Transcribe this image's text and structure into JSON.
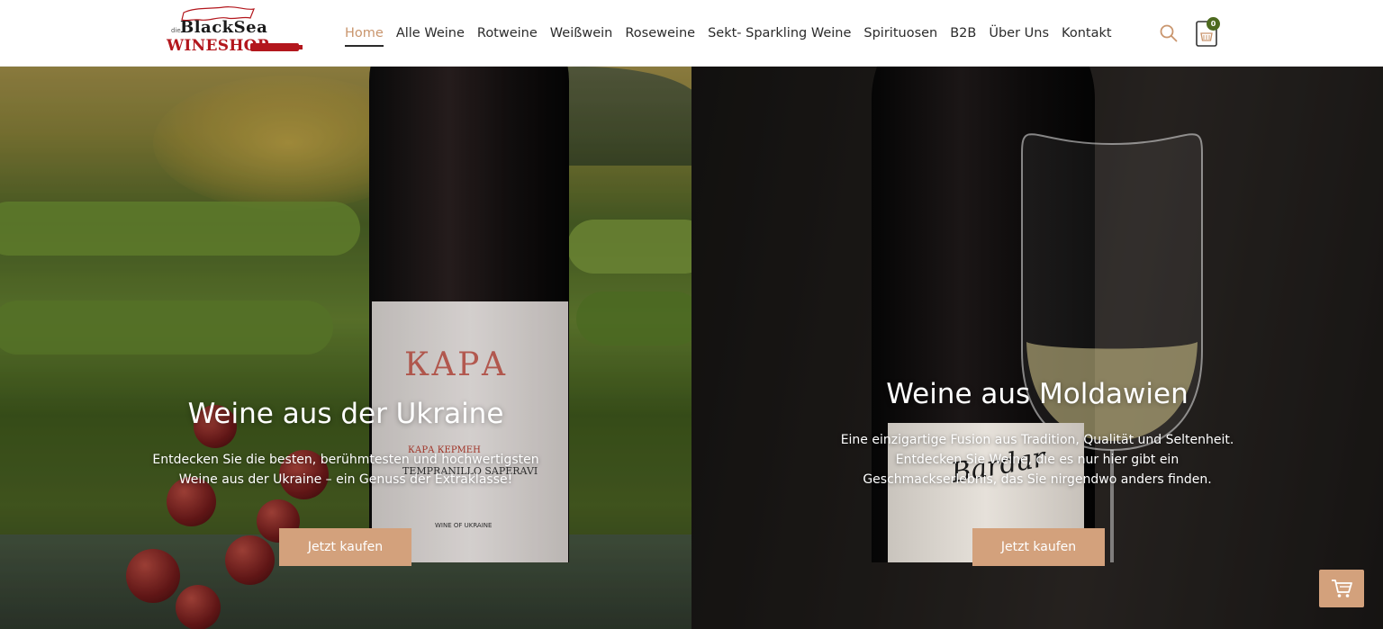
{
  "header": {
    "logo": {
      "small_text": "die",
      "line1": "BlackSea",
      "line2": "WINESHOP"
    },
    "nav": [
      {
        "label": "Home",
        "active": true
      },
      {
        "label": "Alle Weine",
        "active": false
      },
      {
        "label": "Rotweine",
        "active": false
      },
      {
        "label": "Weißwein",
        "active": false
      },
      {
        "label": "Roseweine",
        "active": false
      },
      {
        "label": "Sekt- Sparkling Weine",
        "active": false
      },
      {
        "label": "Spirituosen",
        "active": false
      },
      {
        "label": "B2B",
        "active": false
      },
      {
        "label": "Über Uns",
        "active": false
      },
      {
        "label": "Kontakt",
        "active": false
      }
    ],
    "search_icon": "search-icon",
    "cart": {
      "icon": "shopping-basket-icon",
      "count": "0"
    }
  },
  "hero_left": {
    "title": "Weine aus der Ukraine",
    "text_line1": "Entdecken Sie die besten, berühmtesten und hochwertigsten",
    "text_line2": "Weine aus der Ukraine – ein Genuss der Extraklasse!",
    "button": "Jetzt kaufen",
    "bottle_label": {
      "brand": "КАРА",
      "name": "КАРА КЕРМЕН",
      "variety": "TEMPRANILLO SAPERAVI",
      "origin": "WINE OF UKRAINE"
    }
  },
  "hero_right": {
    "title": "Weine aus Moldawien",
    "text_line1": "Eine einzigartige Fusion aus Tradition, Qualität und Seltenheit.",
    "text_line2": "Entdecken Sie Weine, die es nur hier gibt  ein",
    "text_line3": "Geschmackserlebnis, das Sie nirgendwo anders finden.",
    "button": "Jetzt kaufen",
    "bottle_label": {
      "script": "Bardar"
    }
  },
  "floating_cart": {
    "icon": "cart-icon"
  },
  "colors": {
    "accent": "#d3a17c",
    "nav_active": "#c9956d",
    "badge": "#4d6a1f",
    "logo_red": "#b3171d"
  }
}
